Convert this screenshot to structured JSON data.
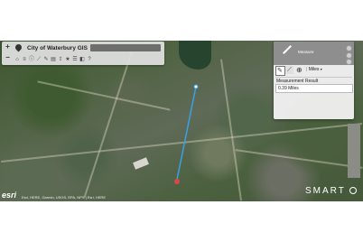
{
  "app": {
    "title": "City of Waterbury GIS",
    "zoom_in_label": "+",
    "zoom_out_label": "−",
    "search_placeholder": "",
    "pin_icon": "location-pin-icon",
    "toolbar_icons": [
      "home-icon",
      "layers-icon",
      "identify-icon",
      "measure-icon",
      "draw-icon",
      "print-icon",
      "share-icon",
      "bookmark-icon",
      "legend-icon",
      "basemap-icon",
      "help-icon"
    ]
  },
  "measure": {
    "title": "Measure",
    "tools": [
      "area-tool-icon",
      "distance-tool-icon",
      "location-tool-icon"
    ],
    "unit_label": "Miles",
    "result_label": "Measurement Result",
    "result_value": "0.39 Miles",
    "colors": {
      "line": "#3aa0e8",
      "end_marker": "#d84848"
    }
  },
  "map_footer": {
    "esri_logo": "esri",
    "attribution": "Esri, HERE, Garmin, USGS, EPA, NPS | Esri, HERE",
    "brand": "SMART"
  }
}
